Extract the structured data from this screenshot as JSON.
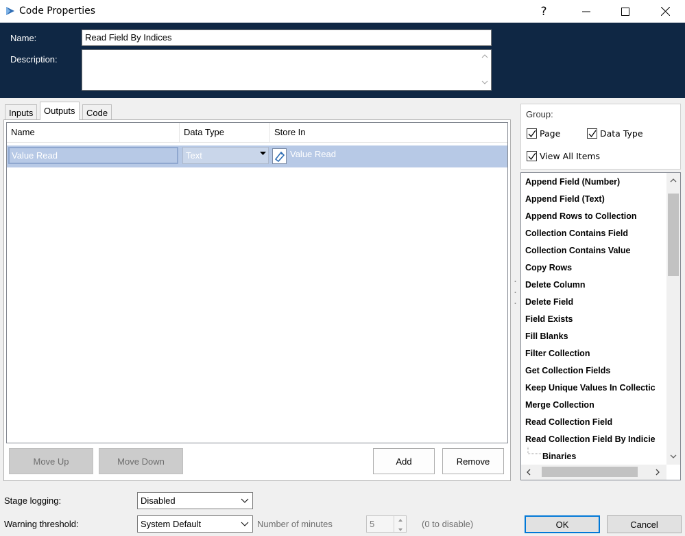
{
  "window": {
    "title": "Code Properties",
    "help": "?"
  },
  "header": {
    "name_label": "Name:",
    "name_value": "Read Field By Indices",
    "description_label": "Description:",
    "description_value": ""
  },
  "tabs": [
    {
      "label": "Inputs",
      "active": false
    },
    {
      "label": "Outputs",
      "active": true
    },
    {
      "label": "Code",
      "active": false
    }
  ],
  "grid": {
    "columns": [
      "Name",
      "Data Type",
      "Store In"
    ],
    "rows": [
      {
        "name": "Value Read",
        "data_type": "Text",
        "store_in": "Value Read"
      }
    ]
  },
  "buttons": {
    "move_up": "Move Up",
    "move_down": "Move Down",
    "add": "Add",
    "remove": "Remove",
    "ok": "OK",
    "cancel": "Cancel"
  },
  "group": {
    "label": "Group:",
    "page": {
      "label": "Page",
      "checked": true
    },
    "data_type": {
      "label": "Data Type",
      "checked": true
    },
    "view_all": {
      "label": "View All Items",
      "checked": true
    }
  },
  "action_list": [
    "Append Field (Number)",
    "Append Field (Text)",
    "Append Rows to Collection",
    "Collection Contains Field",
    "Collection Contains Value",
    "Copy Rows",
    "Delete Column",
    "Delete Field",
    "Field Exists",
    "Fill Blanks",
    "Filter Collection",
    "Get Collection Fields",
    "Keep Unique Values In Collectic",
    "Merge Collection",
    "Read Collection Field",
    "Read Collection Field By Indicie"
  ],
  "action_list_child": "Binaries",
  "bottom": {
    "stage_logging_label": "Stage logging:",
    "stage_logging_value": "Disabled",
    "warning_label": "Warning threshold:",
    "warning_value": "System Default",
    "minutes_label": "Number of minutes",
    "minutes_value": "5",
    "zero_label": "(0 to disable)"
  },
  "colors": {
    "header_bg": "#0f2744",
    "row_selected": "#b7c9e6",
    "accent": "#0078d7"
  }
}
